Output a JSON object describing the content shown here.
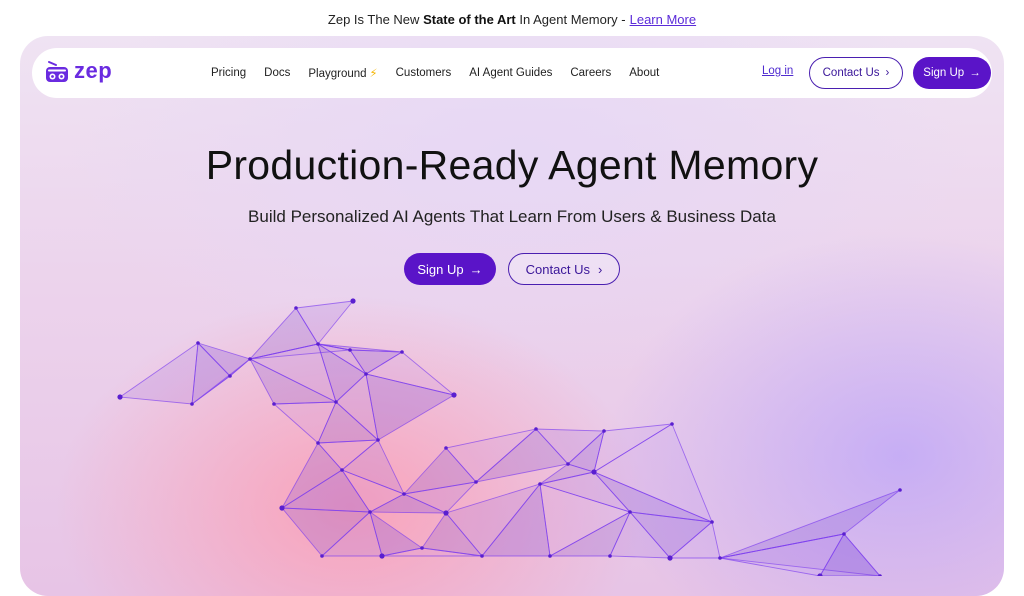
{
  "announcement": {
    "prefix": "Zep Is The New",
    "bold": "State of the Art",
    "suffix": "In Agent Memory -",
    "link": "Learn More"
  },
  "brand": {
    "name": "zep",
    "logo_icon": "robot-radio-icon",
    "color": "#6a2be0"
  },
  "nav": {
    "links": [
      "Pricing",
      "Docs",
      "Playground",
      "Customers",
      "AI Agent Guides",
      "Careers",
      "About"
    ],
    "playground_icon": "lightning-icon",
    "login": "Log in",
    "contact": "Contact Us",
    "signup": "Sign Up"
  },
  "hero": {
    "title": "Production-Ready Agent Memory",
    "subtitle": "Build Personalized AI Agents That Learn From Users & Business Data",
    "primary_cta": "Sign Up",
    "secondary_cta": "Contact Us"
  },
  "colors": {
    "accent": "#5a14c8",
    "link": "#5b2bd9",
    "mesh": "#7b3cf0"
  }
}
